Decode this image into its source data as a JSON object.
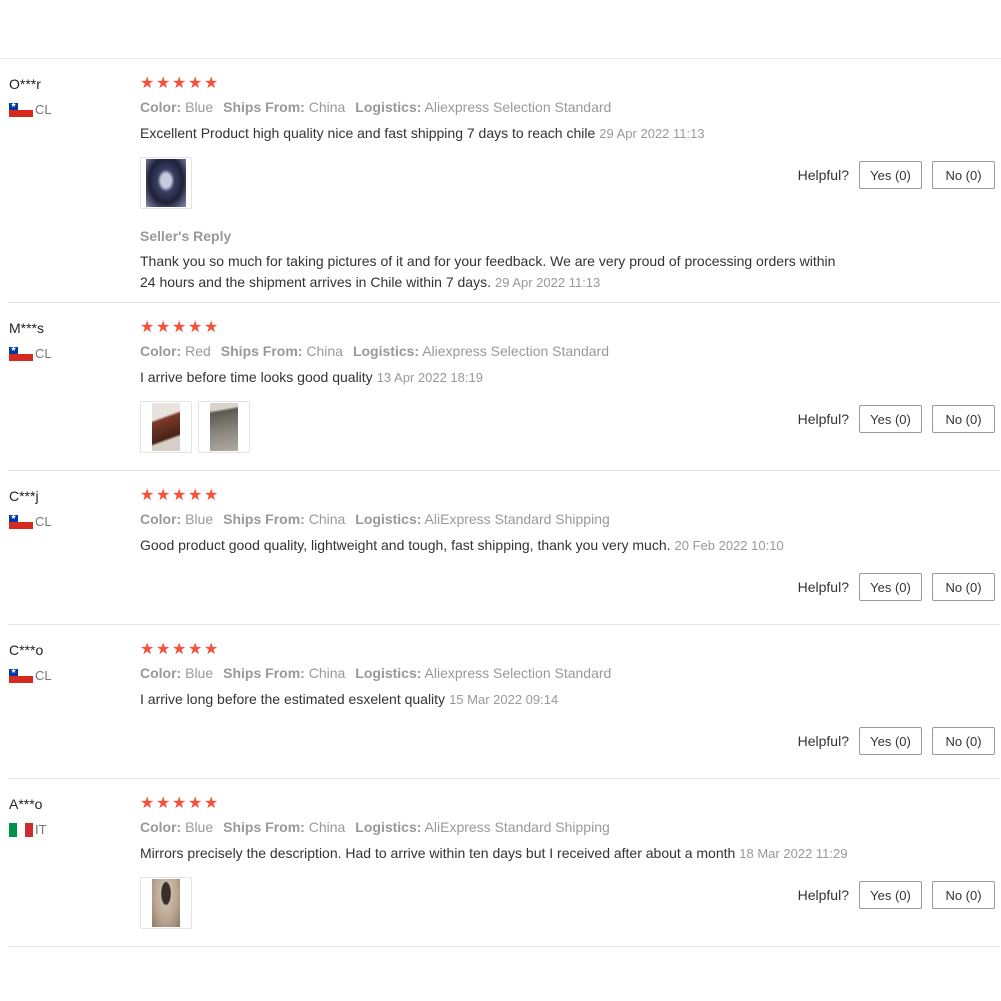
{
  "labels": {
    "color": "Color:",
    "ships_from": "Ships From:",
    "logistics": "Logistics:",
    "helpful": "Helpful?",
    "seller_reply_title": "Seller's Reply"
  },
  "reviews": [
    {
      "user": "O***r",
      "country": "CL",
      "rating": 5,
      "color": "Blue",
      "ships_from": "China",
      "logistics": "Aliexpress Selection Standard",
      "text": "Excellent Product high quality nice and fast shipping 7 days to reach chile",
      "date": "29 Apr 2022 11:13",
      "photos": 1,
      "yes": "Yes (0)",
      "no": "No (0)",
      "seller_reply": {
        "text": "Thank you so much for taking pictures of it and for your feedback. We are very proud of processing orders within 24 hours and the shipment arrives in Chile within 7 days.",
        "date": "29 Apr 2022 11:13"
      }
    },
    {
      "user": "M***s",
      "country": "CL",
      "rating": 5,
      "color": "Red",
      "ships_from": "China",
      "logistics": "Aliexpress Selection Standard",
      "text": "I arrive before time looks good quality",
      "date": "13 Apr 2022 18:19",
      "photos": 2,
      "yes": "Yes (0)",
      "no": "No (0)"
    },
    {
      "user": "C***j",
      "country": "CL",
      "rating": 5,
      "color": "Blue",
      "ships_from": "China",
      "logistics": "AliExpress Standard Shipping",
      "text": "Good product good quality, lightweight and tough, fast shipping, thank you very much.",
      "date": "20 Feb 2022 10:10",
      "photos": 0,
      "yes": "Yes (0)",
      "no": "No (0)"
    },
    {
      "user": "C***o",
      "country": "CL",
      "rating": 5,
      "color": "Blue",
      "ships_from": "China",
      "logistics": "Aliexpress Selection Standard",
      "text": "I arrive long before the estimated esxelent quality",
      "date": "15 Mar 2022 09:14",
      "photos": 0,
      "yes": "Yes (0)",
      "no": "No (0)"
    },
    {
      "user": "A***o",
      "country": "IT",
      "rating": 5,
      "color": "Blue",
      "ships_from": "China",
      "logistics": "AliExpress Standard Shipping",
      "text": "Mirrors precisely the description. Had to arrive within ten days but I received after about a month",
      "date": "18 Mar 2022 11:29",
      "photos": 1,
      "yes": "Yes (0)",
      "no": "No (0)"
    }
  ],
  "colors": {
    "star": "#f5503c",
    "muted": "#999999",
    "text": "#333333",
    "divider": "#e4e4e4"
  }
}
